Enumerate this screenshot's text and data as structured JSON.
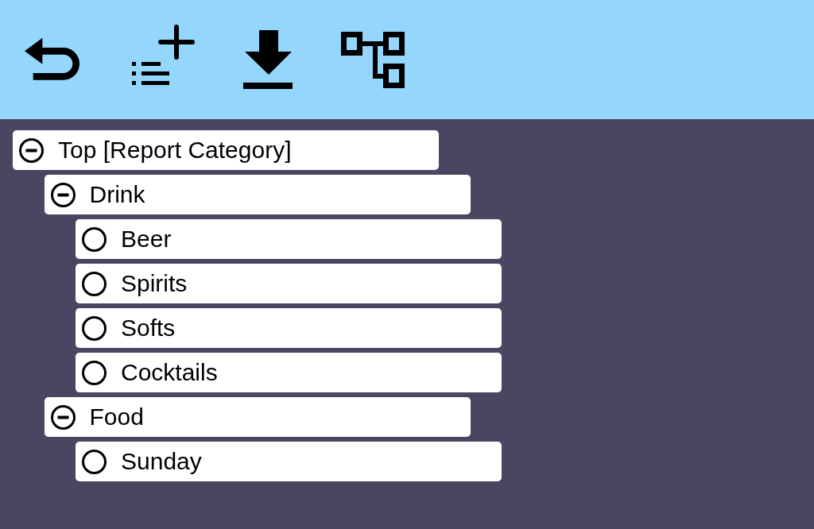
{
  "tree": [
    {
      "label": "Top [Report Category]",
      "expanded": true,
      "children": [
        {
          "label": "Drink",
          "expanded": true,
          "children": [
            {
              "label": "Beer"
            },
            {
              "label": "Spirits"
            },
            {
              "label": "Softs"
            },
            {
              "label": "Cocktails"
            }
          ]
        },
        {
          "label": "Food",
          "expanded": true,
          "children": [
            {
              "label": "Sunday"
            }
          ]
        }
      ]
    }
  ]
}
